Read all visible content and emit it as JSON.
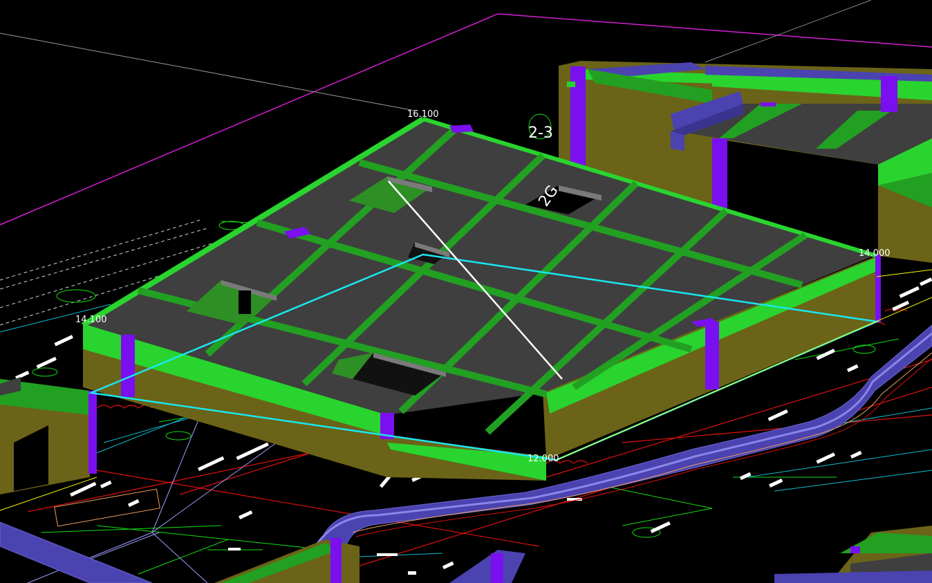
{
  "viewport": {
    "title": "",
    "background_color": "#000000",
    "colors": {
      "slab_top": "#3f3f3f",
      "beam": "#22a022",
      "beam_bright": "#29d42e",
      "wall": "#6b6318",
      "column": "#7a0ff0",
      "duct": "#4a43b0",
      "selection": "#19e7f0",
      "boundary": "#d21ed2",
      "measure_line": "#ffffff",
      "cad_red": "#e01010",
      "cad_green": "#10e010",
      "cad_cyan": "#10c0d0"
    }
  },
  "elevations": {
    "top": "16.100",
    "left": "14.100",
    "right": "14.000",
    "bottom": "12.000"
  },
  "grid_labels": {
    "axis_2_3": "2-3",
    "axis_partial": "2G"
  }
}
